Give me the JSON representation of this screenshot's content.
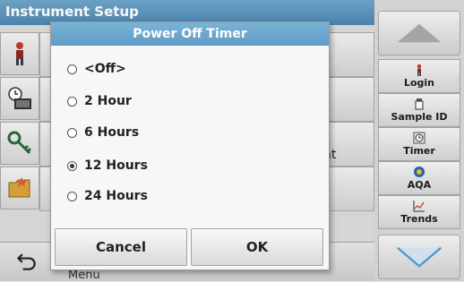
{
  "background": {
    "title": "Instrument Setup",
    "row3_partial_text": "nt",
    "bottom_partial_text": "Menu"
  },
  "left_icons": [
    "person-icon",
    "clock-keyboard-icon",
    "key-icon",
    "folder-icon"
  ],
  "sidebar": {
    "items": [
      {
        "label": "Login",
        "icon": "person-icon"
      },
      {
        "label": "Sample ID",
        "icon": "sample-bottle-icon"
      },
      {
        "label": "Timer",
        "icon": "timer-icon"
      },
      {
        "label": "AQA",
        "icon": "aqa-icon"
      },
      {
        "label": "Trends",
        "icon": "trends-chart-icon"
      }
    ]
  },
  "dialog": {
    "title": "Power Off Timer",
    "options": [
      {
        "label": "<Off>",
        "selected": false
      },
      {
        "label": "2 Hour",
        "selected": false
      },
      {
        "label": "6 Hours",
        "selected": false
      },
      {
        "label": "12 Hours",
        "selected": true
      },
      {
        "label": "24 Hours",
        "selected": false
      }
    ],
    "cancel_label": "Cancel",
    "ok_label": "OK"
  },
  "colors": {
    "title_bar": "#5f9bc5",
    "arrow_blue": "#4a9ed8"
  }
}
